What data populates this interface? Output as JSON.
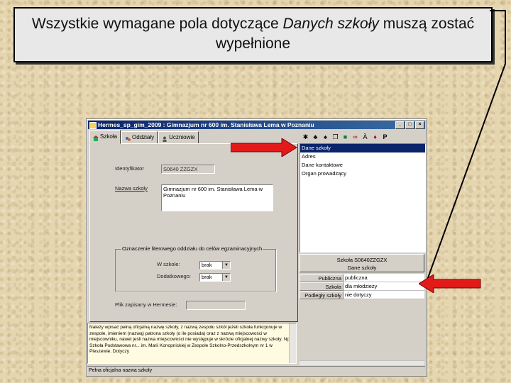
{
  "slide": {
    "caption_part1": "Wszystkie wymagane pola dotyczące ",
    "caption_italic": "Danych szkoły",
    "caption_part2": " muszą zostać wypełnione"
  },
  "window": {
    "title": "Hermes_sp_gim_2009 : Gimnazjum nr 600 im. Stanisława Lema w Poznaniu",
    "controls": [
      "_",
      "□",
      "×"
    ]
  },
  "tabs": [
    {
      "label": "Szkoła",
      "icon": "school-icon"
    },
    {
      "label": "Oddziały",
      "icon": "class-icon"
    },
    {
      "label": "Uczniowie",
      "icon": "students-icon"
    }
  ],
  "form": {
    "identifier_label": "Identyfikator",
    "identifier_value": "S0640 ZZGZX",
    "name_label": "Nazwa szkoły",
    "name_value": "Gimnazjum nr 600 im. Stanisława Lema w Poznaniu",
    "group_title": "Oznaczenie literowego oddziału do celów egzaminacyjnych",
    "in_school_label": "W szkole:",
    "in_school_value": "brak",
    "additional_label": "Dodatkowego:",
    "additional_value": "brak",
    "file_label": "Plik zapisany w Hermesie:",
    "file_value": ""
  },
  "description": "Należy wpisać pełną oficjalną nazwę szkoły, z nazwą zespołu szkół jeżeli szkoła funkcjonuje w zespole, imieniem (nazwą) patrona szkoły (o ile posiada) oraz z nazwą miejscowości w miejscowniku, nawet jeśli nazwa miejscowości nie występuje w skrócie oficjalnej nazwy szkoły. Np. Szkoła Podstawowa nr... im. Marii Konopnickiej w Zespole Szkolno-Przedszkolnym nr 1 w Pleszewie. Dotyczy",
  "status_text": "Pełna oficjalna nazwa szkoły",
  "toolbar_icons": [
    "tools-icon",
    "users-icon",
    "group-icon",
    "copy-icon",
    "save-icon",
    "binoculars-icon",
    "font-icon",
    "book-icon",
    "p-icon"
  ],
  "toolbar_p_label": "P",
  "list_items": [
    "Dane szkoły",
    "Adres",
    "Dane kontaktowe",
    "Organ prowadzący"
  ],
  "info_line1": "Szkoła S0640ZZGZX",
  "info_line2": "Dane szkoły",
  "properties": [
    {
      "key": "Publiczna",
      "value": "publiczna"
    },
    {
      "key": "Szkoła",
      "value": "dla młodzieży"
    },
    {
      "key": "Podległy szkoły",
      "value": "nie dotyczy"
    }
  ],
  "colors": {
    "arrow": "#e21a1a",
    "titlebar": "#0a246a",
    "selection": "#0a246a"
  }
}
